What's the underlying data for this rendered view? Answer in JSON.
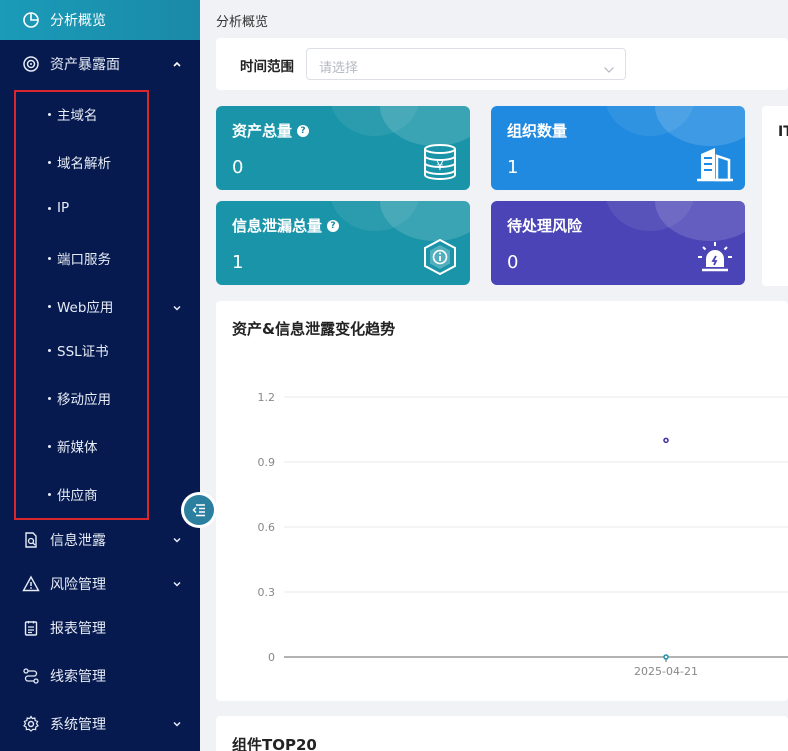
{
  "sidebar": {
    "top": {
      "label": "分析概览",
      "icon": "pie-chart-icon"
    },
    "exposure": {
      "label": "资产暴露面",
      "icon": "target-icon"
    },
    "sub_items": [
      {
        "label": "主域名"
      },
      {
        "label": "域名解析"
      },
      {
        "label": "IP"
      },
      {
        "label": "端口服务"
      },
      {
        "label": "Web应用"
      },
      {
        "label": "SSL证书"
      },
      {
        "label": "移动应用"
      },
      {
        "label": "新媒体"
      },
      {
        "label": "供应商"
      }
    ],
    "items": [
      {
        "label": "信息泄露",
        "icon": "document-search-icon"
      },
      {
        "label": "风险管理",
        "icon": "warning-icon"
      },
      {
        "label": "报表管理",
        "icon": "report-icon"
      },
      {
        "label": "线索管理",
        "icon": "route-icon"
      },
      {
        "label": "系统管理",
        "icon": "gear-icon"
      }
    ]
  },
  "breadcrumb": "分析概览",
  "filter": {
    "label": "时间范围",
    "placeholder": "请选择"
  },
  "cards": [
    {
      "title": "资产总量",
      "value": "0",
      "color": "#1a94a8",
      "icon": "coins-icon"
    },
    {
      "title": "组织数量",
      "value": "1",
      "color": "#1f8ae0",
      "icon": "building-icon"
    },
    {
      "title": "信息泄漏总量",
      "value": "1",
      "color": "#1a94a8",
      "icon": "shield-info-icon"
    },
    {
      "title": "待处理风险",
      "value": "0",
      "color": "#4a44b6",
      "icon": "alarm-icon"
    }
  ],
  "side_card_title": "IT",
  "trend": {
    "title": "资产&信息泄露变化趋势"
  },
  "bottom_title": "组件TOP20",
  "chart_data": {
    "type": "line",
    "title": "资产&信息泄露变化趋势",
    "x": [
      "2025-04-21"
    ],
    "series": [
      {
        "values": [
          1
        ],
        "color": "#3a2fa0"
      },
      {
        "values": [
          0
        ],
        "color": "#1a94a8"
      }
    ],
    "yticks": [
      "0",
      "0.3",
      "0.6",
      "0.9",
      "1.2"
    ],
    "ylim": [
      0,
      1.2
    ],
    "grid": true
  }
}
